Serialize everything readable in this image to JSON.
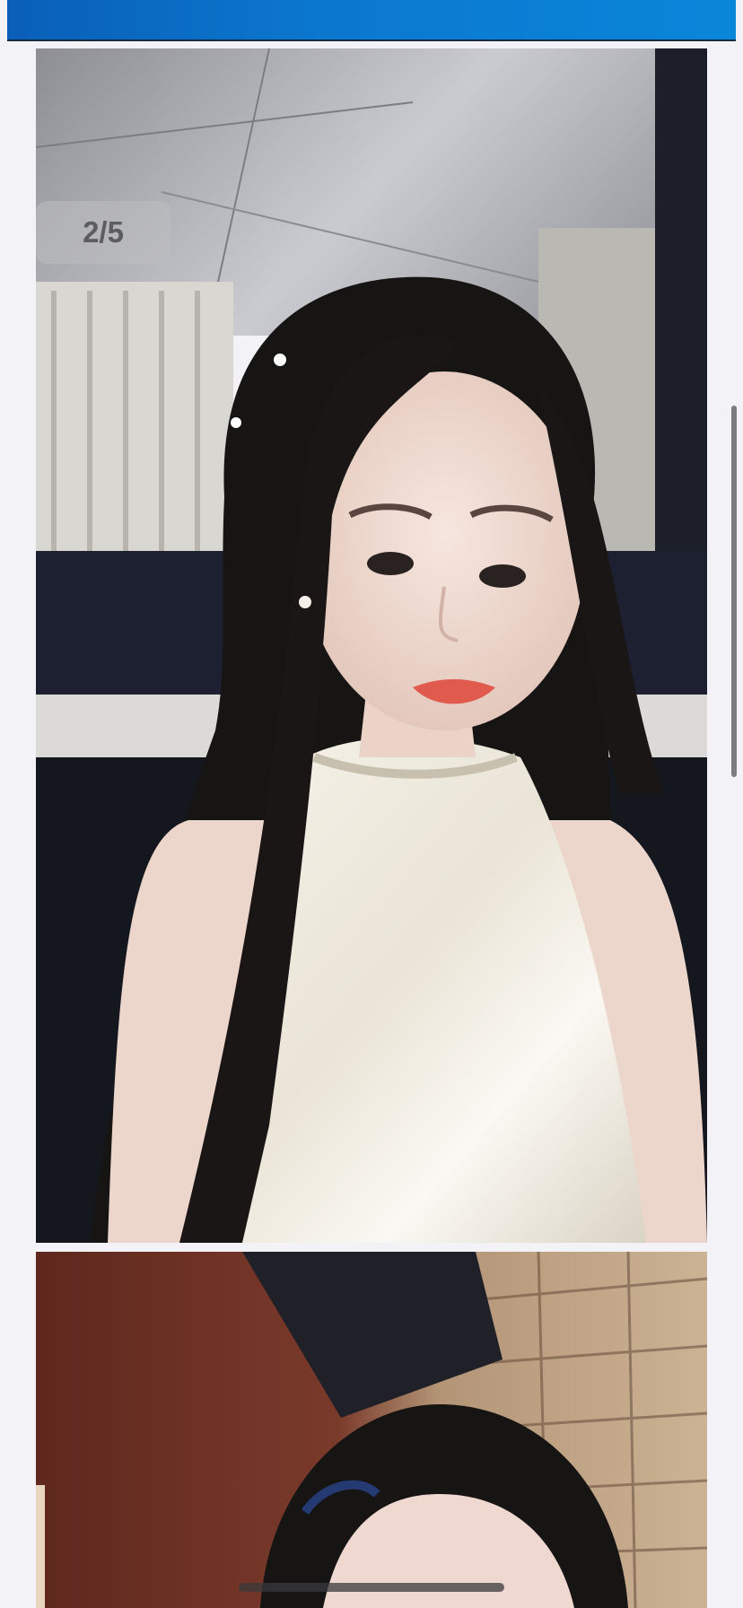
{
  "header": {
    "accent_color": "#0a78cf"
  },
  "gallery": {
    "counter": "2/5",
    "current_index": 2,
    "total": 5,
    "photos": [
      {
        "icon": "portrait-photo",
        "description_color": "#f4f2ee"
      },
      {
        "icon": "portrait-photo",
        "description_color": "#5a2a1e"
      }
    ]
  },
  "system": {
    "scroll_position": 0.27
  }
}
